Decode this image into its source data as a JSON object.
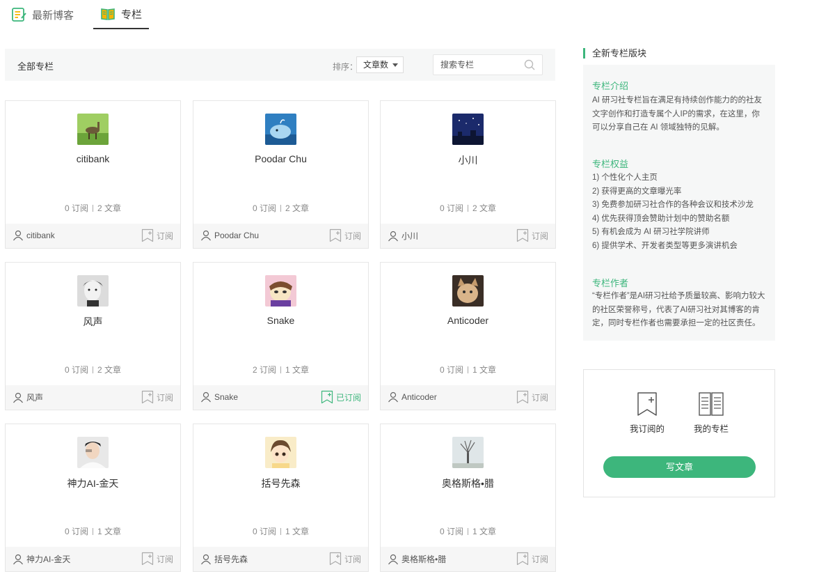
{
  "tabs": [
    {
      "label": "最新博客",
      "icon": "edit-note-icon"
    },
    {
      "label": "专栏",
      "icon": "open-book-icon",
      "active": true
    }
  ],
  "filter": {
    "title": "全部专栏",
    "sort_label": "排序：",
    "sort_value": "文章数",
    "search_placeholder": "搜索专栏"
  },
  "columns": [
    {
      "name": "citibank",
      "subs": "0 订阅",
      "articles": "2 文章",
      "author": "citibank",
      "subscribe": "订阅",
      "subscribed": false,
      "avatar": "llama"
    },
    {
      "name": "Poodar Chu",
      "subs": "0 订阅",
      "articles": "2 文章",
      "author": "Poodar Chu",
      "subscribe": "订阅",
      "subscribed": false,
      "avatar": "whale"
    },
    {
      "name": "小川",
      "subs": "0 订阅",
      "articles": "2 文章",
      "author": "小川",
      "subscribe": "订阅",
      "subscribed": false,
      "avatar": "night"
    },
    {
      "name": "风声",
      "subs": "0 订阅",
      "articles": "2 文章",
      "author": "风声",
      "subscribe": "订阅",
      "subscribed": false,
      "avatar": "bw"
    },
    {
      "name": "Snake",
      "subs": "2 订阅",
      "articles": "1 文章",
      "author": "Snake",
      "subscribe": "已订阅",
      "subscribed": true,
      "avatar": "cartoon"
    },
    {
      "name": "Anticoder",
      "subs": "0 订阅",
      "articles": "1 文章",
      "author": "Anticoder",
      "subscribe": "订阅",
      "subscribed": false,
      "avatar": "cat"
    },
    {
      "name": "神力AI-金天",
      "subs": "0 订阅",
      "articles": "1 文章",
      "author": "神力AI-金天",
      "subscribe": "订阅",
      "subscribed": false,
      "avatar": "person"
    },
    {
      "name": "括号先森",
      "subs": "0 订阅",
      "articles": "1 文章",
      "author": "括号先森",
      "subscribe": "订阅",
      "subscribed": false,
      "avatar": "anime"
    },
    {
      "name": "奥格斯格•腊",
      "subs": "0 订阅",
      "articles": "1 文章",
      "author": "奥格斯格•腊",
      "subscribe": "订阅",
      "subscribed": false,
      "avatar": "tree"
    }
  ],
  "sidebar": {
    "title": "全新专栏版块",
    "intro_title": "专栏介绍",
    "intro_text": "AI 研习社专栏旨在满足有持续创作能力的的社友文字创作和打造专属个人IP的需求，在这里，你可以分享自己在 AI 领域独特的见解。",
    "benefits_title": "专栏权益",
    "benefits": [
      "1) 个性化个人主页",
      "2) 获得更高的文章曝光率",
      "3) 免费参加研习社合作的各种会议和技术沙龙",
      "4) 优先获得顶会赞助计划中的赞助名额",
      "5) 有机会成为 AI 研习社学院讲师",
      "6) 提供学术、开发者类型等更多演讲机会"
    ],
    "author_title": "专栏作者",
    "author_text": "“专栏作者”是AI研习社给予质量较高、影响力较大的社区荣誉称号，代表了AI研习社对其博客的肯定，同时专栏作者也需要承担一定的社区责任。",
    "my_subs": "我订阅的",
    "my_columns": "我的专栏",
    "write": "写文章"
  },
  "colors": {
    "accent": "#3db67c"
  }
}
